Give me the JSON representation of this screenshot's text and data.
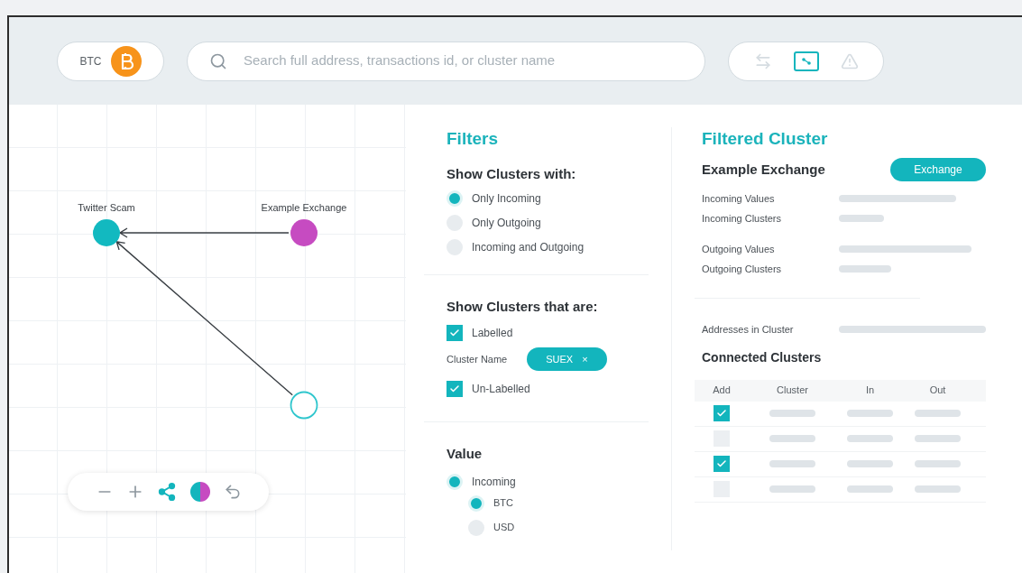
{
  "currency": {
    "label": "BTC"
  },
  "search": {
    "placeholder": "Search full address, transactions id, or cluster name"
  },
  "view_toggles": [
    {
      "kind": "swap",
      "selected": false
    },
    {
      "kind": "graph",
      "selected": true
    },
    {
      "kind": "alert",
      "selected": false
    }
  ],
  "graph": {
    "nodes": [
      {
        "label": "Twitter Scam",
        "kind": "filled",
        "color": "#12b9c0"
      },
      {
        "label": "Example Exchange",
        "kind": "filled",
        "color": "#c64bc1"
      },
      {
        "kind": "empty",
        "color": "#2fc6cd"
      }
    ]
  },
  "filters": {
    "title": "Filters",
    "with_heading": "Show Clusters with:",
    "with_options": [
      {
        "label": "Only Incoming",
        "selected": true
      },
      {
        "label": "Only Outgoing",
        "selected": false
      },
      {
        "label": "Incoming and Outgoing",
        "selected": false
      }
    ],
    "that_are_heading": "Show Clusters that are:",
    "labelled": {
      "label": "Labelled",
      "checked": true
    },
    "cluster_name": {
      "label": "Cluster Name",
      "tag": "SUEX",
      "remove": "×"
    },
    "unlabelled": {
      "label": "Un-Labelled",
      "checked": true
    },
    "value_heading": "Value",
    "value_options": [
      {
        "label": "Incoming",
        "selected": true,
        "children": [
          {
            "label": "BTC",
            "selected": true
          },
          {
            "label": "USD",
            "selected": false
          }
        ]
      }
    ]
  },
  "filtered_cluster": {
    "title": "Filtered Cluster",
    "name": "Example Exchange",
    "badge": "Exchange",
    "stat_groups": [
      [
        "Incoming Values",
        "Incoming Clusters"
      ],
      [
        "Outgoing Values",
        "Outgoing Clusters"
      ]
    ],
    "addresses_label": "Addresses in Cluster",
    "connected_title": "Connected Clusters",
    "table": {
      "columns": [
        "Add",
        "Cluster",
        "In",
        "Out"
      ],
      "rows": [
        {
          "checked": true
        },
        {
          "checked": false
        },
        {
          "checked": true
        },
        {
          "checked": false
        }
      ]
    }
  }
}
